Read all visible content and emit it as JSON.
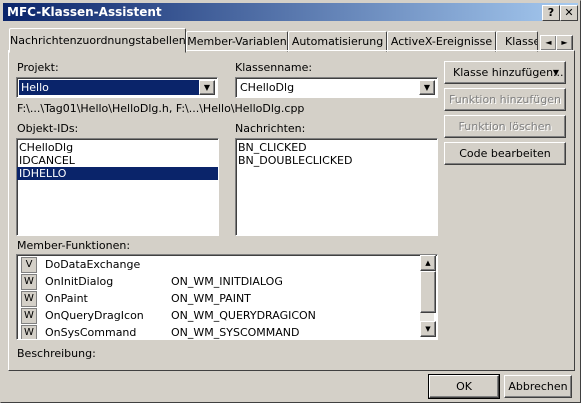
{
  "window": {
    "title": "MFC-Klassen-Assistent",
    "help_label": "?",
    "close_label": "✕"
  },
  "tabs": [
    {
      "label": "Nachrichtenzuordnungstabellen"
    },
    {
      "label": "Member-Variablen"
    },
    {
      "label": "Automatisierung"
    },
    {
      "label": "ActiveX-Ereignisse"
    },
    {
      "label": "Klassen-Info"
    }
  ],
  "tab_scroll": {
    "left_label": "◄",
    "right_label": "►"
  },
  "projekt": {
    "label": "Projekt:",
    "value": "Hello"
  },
  "klassenname": {
    "label": "Klassenname:",
    "value": "CHelloDlg"
  },
  "file_path": "F:\\...\\Tag01\\Hello\\HelloDlg.h, F:\\...\\Hello\\HelloDlg.cpp",
  "objekt_ids": {
    "label": "Objekt-IDs:",
    "items": [
      "CHelloDlg",
      "IDCANCEL",
      "IDHELLO"
    ],
    "selected": "IDHELLO"
  },
  "nachrichten": {
    "label": "Nachrichten:",
    "items": [
      "BN_CLICKED",
      "BN_DOUBLECLICKED"
    ]
  },
  "member_funktionen": {
    "label": "Member-Funktionen:",
    "rows": [
      {
        "mark": "V",
        "name": "DoDataExchange",
        "message": ""
      },
      {
        "mark": "W",
        "name": "OnInitDialog",
        "message": "ON_WM_INITDIALOG"
      },
      {
        "mark": "W",
        "name": "OnPaint",
        "message": "ON_WM_PAINT"
      },
      {
        "mark": "W",
        "name": "OnQueryDragIcon",
        "message": "ON_WM_QUERYDRAGICON"
      },
      {
        "mark": "W",
        "name": "OnSysCommand",
        "message": "ON_WM_SYSCOMMAND"
      }
    ]
  },
  "buttons": {
    "klasse_hinzufuegen": "Klasse hinzufügen...",
    "klasse_arrow": "▼",
    "funktion_hinzufuegen": "Funktion hinzufügen",
    "funktion_loeschen": "Funktion löschen",
    "code_bearbeiten": "Code bearbeiten",
    "ok": "OK",
    "abbrechen": "Abbrechen"
  },
  "beschreibung": {
    "label": "Beschreibung:"
  },
  "scrollbar": {
    "up": "▲",
    "down": "▼"
  },
  "combo_arrow": "▼",
  "colors": {
    "titlebar_start": "#0a246a",
    "titlebar_end": "#a6caf0",
    "selection": "#0a246a",
    "face": "#d4d0c8"
  }
}
